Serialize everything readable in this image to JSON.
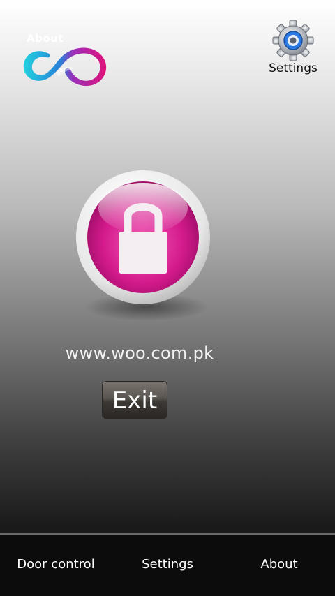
{
  "header": {
    "logo_text": "About",
    "settings_label": "Settings"
  },
  "main": {
    "url": "www.woo.com.pk",
    "exit_label": "Exit"
  },
  "bottom_nav": {
    "items": [
      {
        "label": "Door control"
      },
      {
        "label": "Settings"
      },
      {
        "label": "About"
      }
    ]
  },
  "colors": {
    "accent_pink": "#d41a8c",
    "logo_teal": "#1ec8d8",
    "gear_blue": "#2c7be5"
  },
  "icons": {
    "logo": "infinity-logo-icon",
    "settings": "gear-icon",
    "lock": "padlock-icon"
  }
}
